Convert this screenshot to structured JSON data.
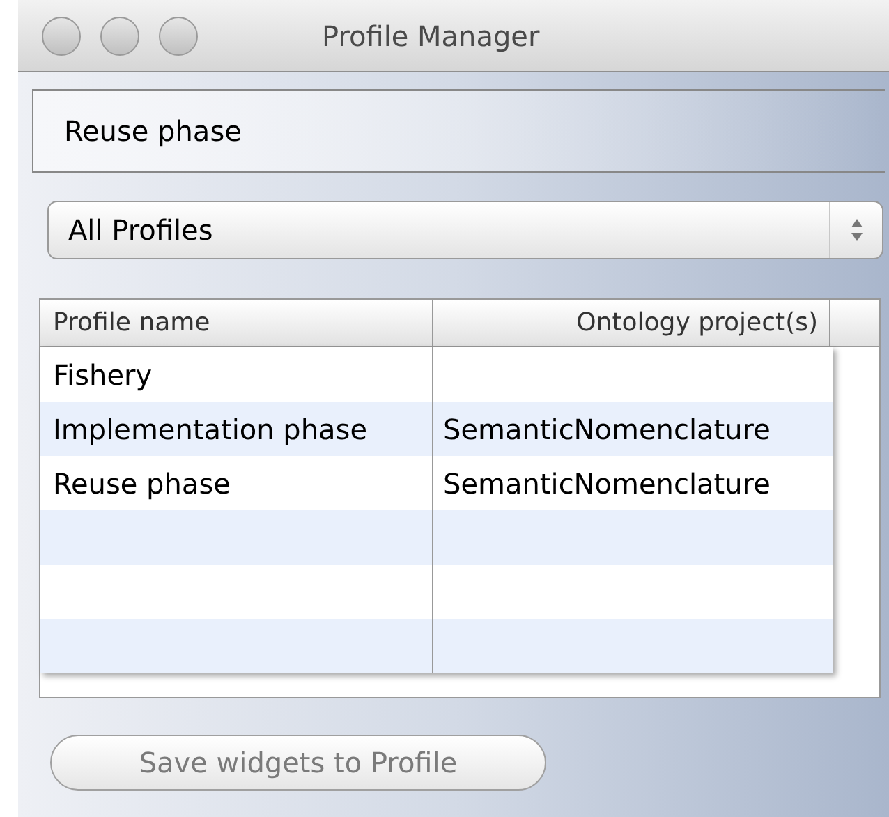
{
  "window": {
    "title": "Profile Manager"
  },
  "current_profile": "Reuse phase",
  "filter_dropdown": {
    "value": "All Profiles"
  },
  "table": {
    "columns": [
      "Profile name",
      "Ontology project(s)"
    ],
    "rows": [
      {
        "cells": [
          "Fishery",
          ""
        ]
      },
      {
        "cells": [
          "Implementation phase",
          "SemanticNomenclature"
        ]
      },
      {
        "cells": [
          "Reuse phase",
          "SemanticNomenclature"
        ]
      }
    ]
  },
  "save_button": {
    "label": "Save widgets to Profile",
    "disabled": true
  }
}
